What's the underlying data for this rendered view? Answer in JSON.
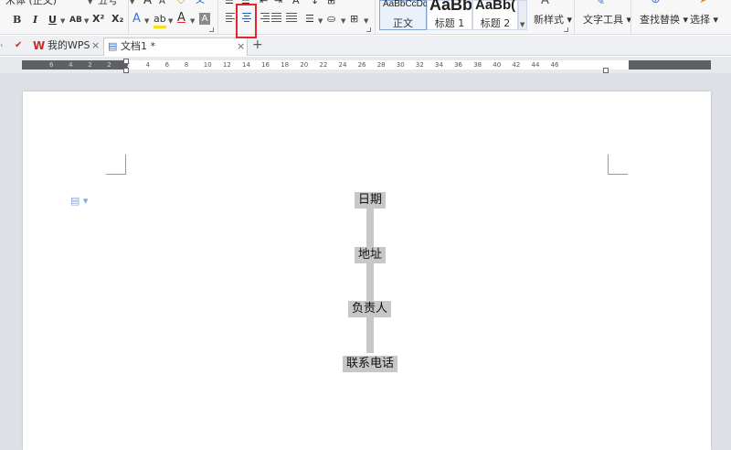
{
  "ribbon": {
    "font_name": "宋体 (正文)",
    "font_size": "五号",
    "format_buttons": {
      "bold": "B",
      "italic": "I",
      "underline": "U",
      "strikethrough": "AB",
      "superscript": "X²",
      "subscript": "X₂"
    },
    "font_letter": "A",
    "styles": [
      {
        "sample": "AaBbCcDd",
        "label": "正文"
      },
      {
        "sample": "AaBb",
        "label": "标题 1"
      },
      {
        "sample": "AaBb(",
        "label": "标题 2"
      }
    ],
    "new_style_label": "新样式",
    "text_tools_label": "文字工具",
    "find_replace_label": "查找替换",
    "select_label": "选择",
    "highlight_color": "#e0282e"
  },
  "tabs": [
    {
      "label": "我的WPS",
      "close": "×"
    },
    {
      "label": "文档1 *",
      "close": "×"
    }
  ],
  "new_tab_symbol": "+",
  "ruler": {
    "numbers": [
      "6",
      "4",
      "2",
      "2",
      "2",
      "4",
      "6",
      "8",
      "10",
      "12",
      "14",
      "16",
      "18",
      "20",
      "22",
      "24",
      "26",
      "28",
      "30",
      "32",
      "34",
      "36",
      "38",
      "40",
      "42",
      "44",
      "46"
    ]
  },
  "document": {
    "fields": [
      "日期",
      "地址",
      "负责人",
      "联系电话"
    ],
    "field_fill_color": "#c7c7c7"
  }
}
